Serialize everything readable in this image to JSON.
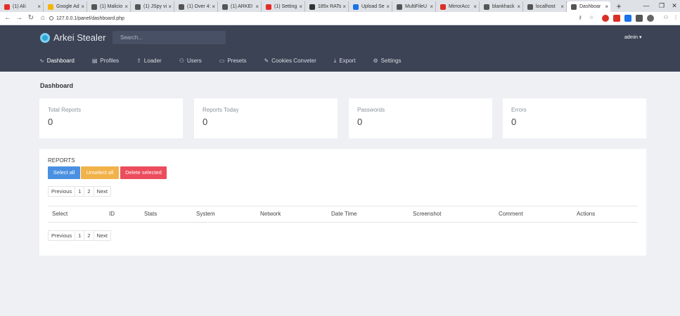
{
  "browser": {
    "tabs": [
      {
        "title": "(1) Ali:",
        "color": "#e52d27"
      },
      {
        "title": "Google Ad",
        "color": "#f4b400"
      },
      {
        "title": "(1) Malicio",
        "color": "#555555"
      },
      {
        "title": "(1) JSpy vi",
        "color": "#555555"
      },
      {
        "title": "(1) Over 4:",
        "color": "#555555"
      },
      {
        "title": "(1) ARKEI",
        "color": "#555555"
      },
      {
        "title": "(1) Setting",
        "color": "#e52d27"
      },
      {
        "title": "185x RATs",
        "color": "#333333"
      },
      {
        "title": "Upload Se",
        "color": "#1a73e8"
      },
      {
        "title": "MultiFileU",
        "color": "#555555"
      },
      {
        "title": "MirrorAcc",
        "color": "#d93025"
      },
      {
        "title": "blankhack",
        "color": "#555555"
      },
      {
        "title": "localhost",
        "color": "#555555"
      },
      {
        "title": "Dashboar",
        "color": "#555555"
      }
    ],
    "url": "127.0.0.1/panel/dashboard.php"
  },
  "header": {
    "brand": "Arkei Stealer",
    "search_placeholder": "Search...",
    "user": "admin ▾"
  },
  "nav": [
    {
      "label": "Dashboard",
      "icon": "activity-icon",
      "glyph": "∿"
    },
    {
      "label": "Profiles",
      "icon": "profiles-icon",
      "glyph": "▤"
    },
    {
      "label": "Loader",
      "icon": "loader-icon",
      "glyph": "⇪"
    },
    {
      "label": "Users",
      "icon": "users-icon",
      "glyph": "⚇"
    },
    {
      "label": "Presets",
      "icon": "presets-icon",
      "glyph": "▭"
    },
    {
      "label": "Cookies Conveter",
      "icon": "edit-icon",
      "glyph": "✎"
    },
    {
      "label": "Export",
      "icon": "export-icon",
      "glyph": "⤓"
    },
    {
      "label": "Settings",
      "icon": "gear-icon",
      "glyph": "⚙"
    }
  ],
  "page_title": "Dashboard",
  "stats": [
    {
      "label": "Total Reports",
      "value": "0"
    },
    {
      "label": "Reports Today",
      "value": "0"
    },
    {
      "label": "Passwords",
      "value": "0"
    },
    {
      "label": "Errors",
      "value": "0"
    }
  ],
  "reports": {
    "title": "REPORTS",
    "select_all": "Select all",
    "unselect_all": "Unselect all",
    "delete_selected": "Delete selected",
    "pager": {
      "prev": "Previous",
      "pages": [
        "1",
        "2"
      ],
      "next": "Next"
    },
    "columns": [
      "Select",
      "ID",
      "Stats",
      "System",
      "Network",
      "Date Time",
      "Screenshot",
      "Comment",
      "Actions"
    ]
  }
}
